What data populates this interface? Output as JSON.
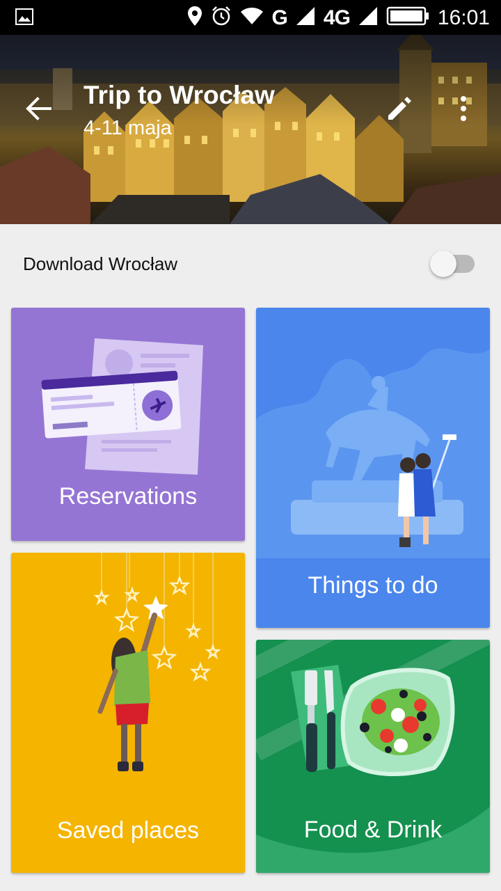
{
  "status_bar": {
    "time": "16:01",
    "network_label": "G",
    "network_label_2": "4G",
    "icons": [
      "image-icon",
      "location-icon",
      "alarm-icon",
      "wifi-icon",
      "signal-icon",
      "battery-icon"
    ]
  },
  "header": {
    "title": "Trip to Wrocław",
    "subtitle": "4-11 maja",
    "back_icon": "arrow-back-icon",
    "edit_icon": "pencil-icon",
    "more_icon": "more-vert-icon"
  },
  "download": {
    "label": "Download Wrocław",
    "enabled": false
  },
  "cards": [
    {
      "label": "Reservations",
      "color": "#9575d4"
    },
    {
      "label": "Things to do",
      "color": "#4a86ec"
    },
    {
      "label": "Saved places",
      "color": "#f4b400"
    },
    {
      "label": "Food & Drink",
      "color": "#14904f"
    }
  ]
}
